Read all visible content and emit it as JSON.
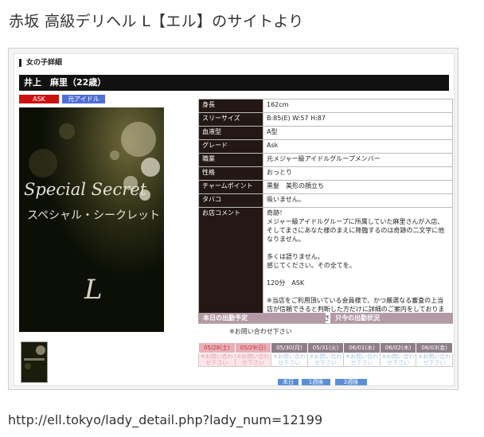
{
  "post": {
    "title": "赤坂 高級デリヘル L【エル】のサイトより",
    "url": "http://ell.tokyo/lady_detail.php?lady_num=12199"
  },
  "page": {
    "section_heading": "女の子詳細",
    "name": "井上　麻里（22歳）",
    "badges": [
      {
        "label": "ASK",
        "color": "#cc1111"
      },
      {
        "label": "元アイドル",
        "color": "#4f6fd6"
      }
    ],
    "photo": {
      "line1": "Special Secret",
      "line2": "スペシャル・シークレット",
      "logo": "L"
    }
  },
  "profile": [
    {
      "label": "身長",
      "value": "162cm"
    },
    {
      "label": "スリーサイズ",
      "value": "B:85(E) W:57 H:87"
    },
    {
      "label": "血液型",
      "value": "A型"
    },
    {
      "label": "グレード",
      "value": "Ask"
    },
    {
      "label": "職業",
      "value": "元メジャー級アイドルグループメンバー"
    },
    {
      "label": "性格",
      "value": "おっとり"
    },
    {
      "label": "チャームポイント",
      "value": "黒髪　美形の顔立ち"
    },
    {
      "label": "タバコ",
      "value": "吸いません。"
    },
    {
      "label": "お店コメント",
      "value": "奇跡！\nメジャー級アイドルグループに所属していた麻里さんが入店、そしてまさにあなた様のまえに降臨するのは奇跡の二文字に他なりません。\n\n多くは語りません。\n感じてください。その全てを。\n\n120分　ASK\n\n※当店をご利用頂いている会員様で、かつ厳選なる審査の上当店が信頼できると判断した方だけに詳細のご案内をしております。予めご了承くださいませ。"
    }
  ],
  "schedule": {
    "today_label": "本日の出勤予定",
    "status_label": "只今の出勤状況",
    "contact": "※お問い合わせ下さい",
    "days": [
      {
        "date": "05/28(土)",
        "text": "※お問い合わせ下さい",
        "weekend": true
      },
      {
        "date": "05/29(日)",
        "text": "※お問い合わせ下さい",
        "weekend": true
      },
      {
        "date": "05/30(月)",
        "text": "※お問い合わせ下さい",
        "weekend": false
      },
      {
        "date": "05/31(火)",
        "text": "※お問い合わせ下さい",
        "weekend": false
      },
      {
        "date": "06/01(水)",
        "text": "※お問い合わせ下さい",
        "weekend": false
      },
      {
        "date": "06/02(木)",
        "text": "※お問い合わせ下さい",
        "weekend": false
      },
      {
        "date": "06/03(金)",
        "text": "※お問い合わせ下さい",
        "weekend": false
      }
    ],
    "nav": [
      "本日",
      "1週後",
      "2週後"
    ]
  }
}
